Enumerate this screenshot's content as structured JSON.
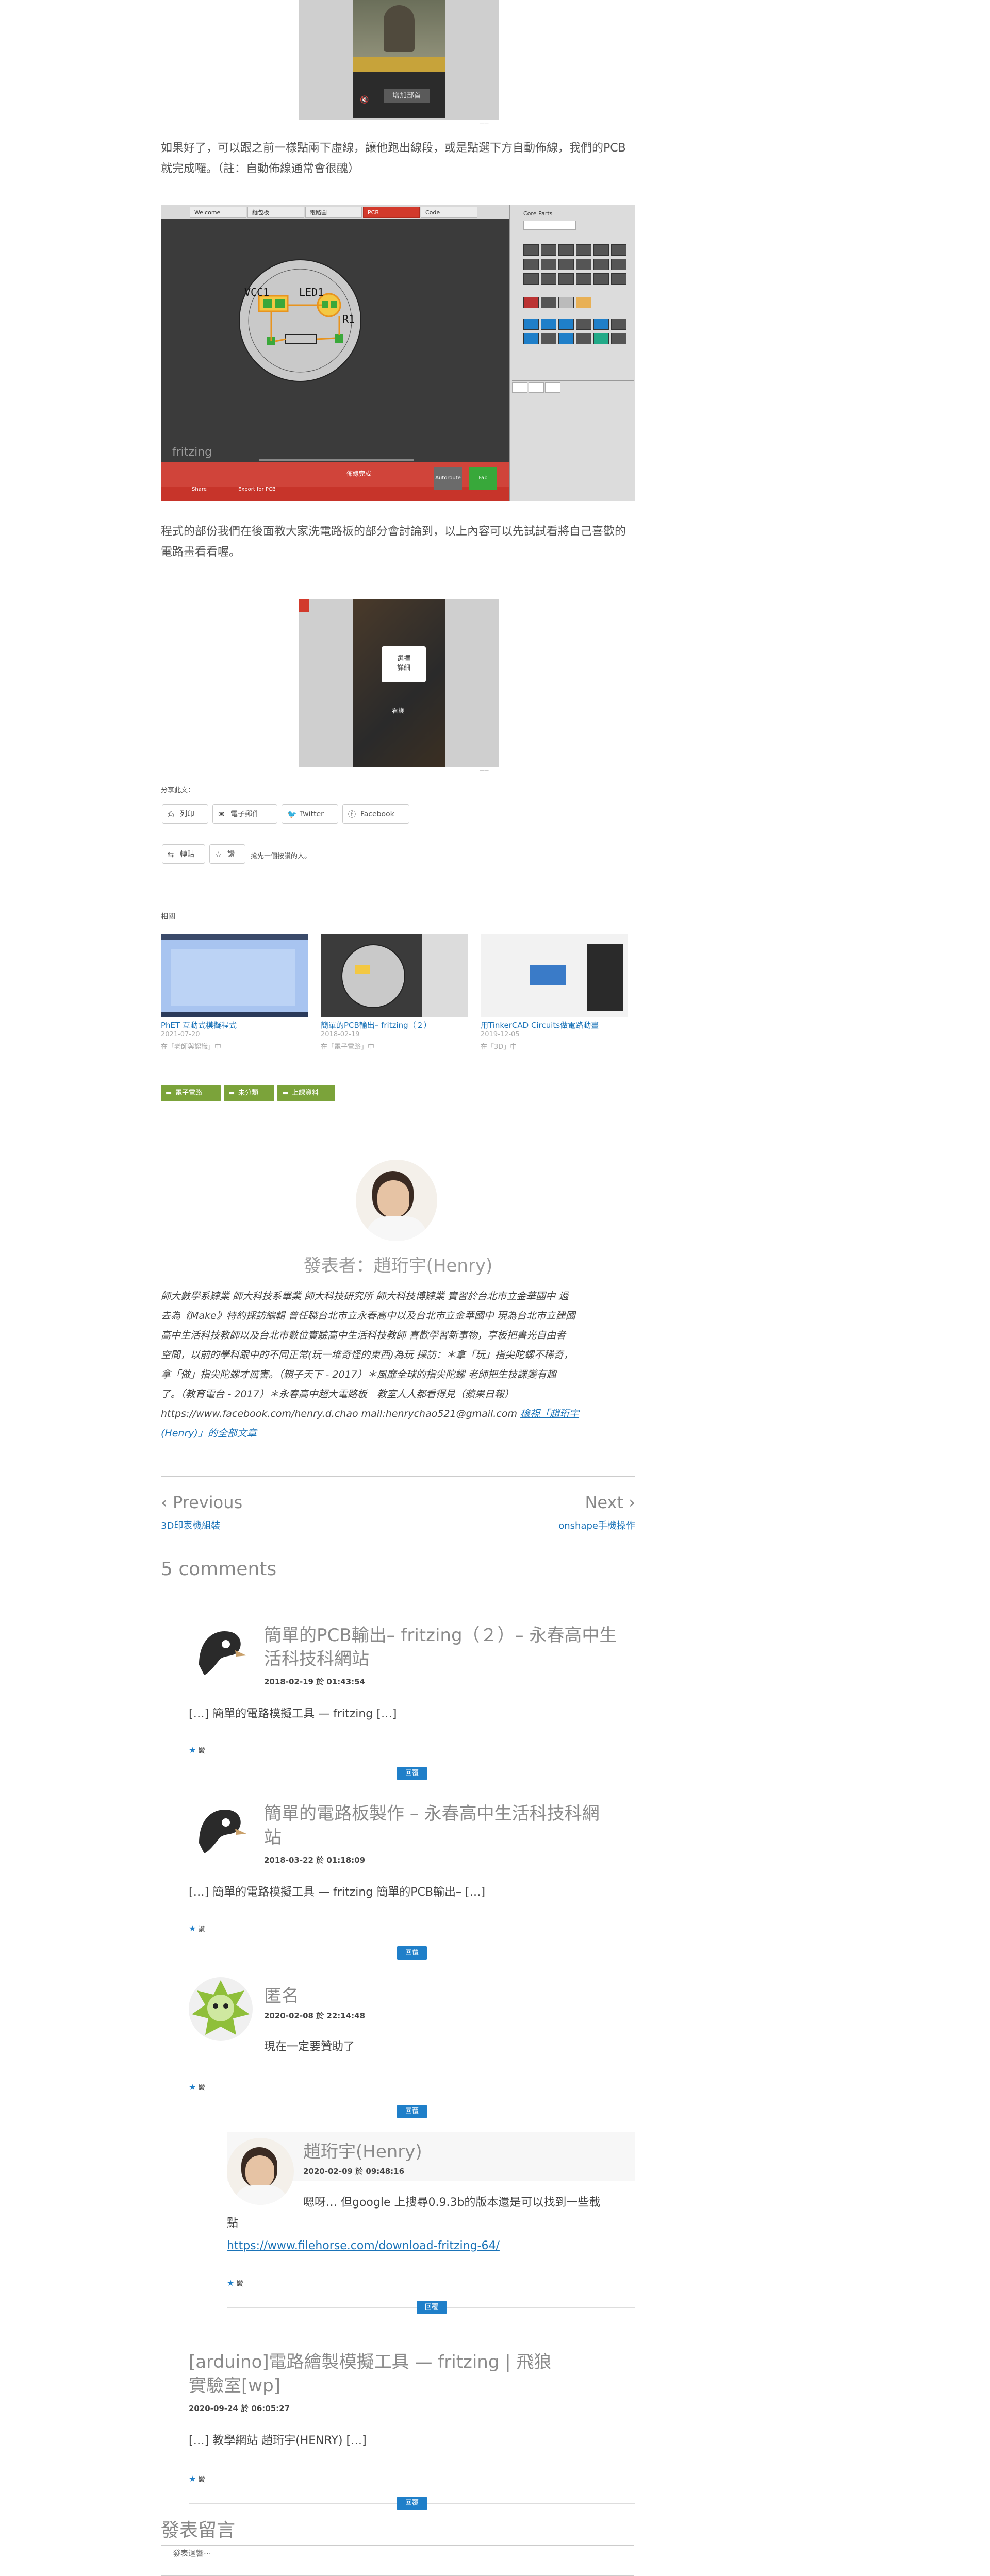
{
  "image_badge": "增加部首",
  "intro_paragraph": "如果好了，可以跟之前一樣點兩下虛線，讓他跑出線段，或是點選下方自動佈線，我們的PCB就完成囉。（註：自動佈線通常會很醜）",
  "fritzing": {
    "tabs": [
      "Welcome",
      "麵包板",
      "電路圖",
      "PCB",
      "Code"
    ],
    "board_labels": [
      "VCC1",
      "LED1",
      "R1"
    ],
    "logo": "fritzing",
    "bottom_label": "佈線完成",
    "bottom_buttons": [
      "Share",
      "Export for PCB",
      "Autoroute",
      "Fab"
    ],
    "panel_title": "Core Parts",
    "footer_buttons": [
      "Autoroute",
      "Fab"
    ]
  },
  "outro_paragraph": "程式的部份我們在後面教大家洗電路板的部分會討論到，以上內容可以先試試看將自己喜歡的電路畫看看喔。",
  "second_phone": {
    "card": "選擇\n詳細",
    "caption": "看護"
  },
  "share": {
    "label": "分享此文：",
    "buttons": [
      {
        "icon": "print-icon",
        "glyph": "⎙",
        "label": "列印"
      },
      {
        "icon": "mail-icon",
        "glyph": "✉",
        "label": "電子郵件"
      },
      {
        "icon": "twitter-icon",
        "glyph": "🐦",
        "label": "Twitter"
      },
      {
        "icon": "facebook-icon",
        "glyph": "ⓕ",
        "label": "Facebook"
      }
    ],
    "reblog": "轉貼",
    "like": "讚",
    "like_text": "搶先一個按讚的人。"
  },
  "related": {
    "label": "相關",
    "items": [
      {
        "title": "PhET 互動式模擬程式",
        "date": "2021-07-20",
        "context": "在「老師與認識」中"
      },
      {
        "title": "簡單的PCB輸出– fritzing（２）",
        "date": "2018-02-19",
        "context": "在「電子電路」中"
      },
      {
        "title": "用TinkerCAD Circuits做電路動畫",
        "date": "2019-12-05",
        "context": "在「3D」中"
      }
    ]
  },
  "tags": [
    "電子電路",
    "未分類",
    "上課資料"
  ],
  "author": {
    "title": "發表者：趙珩宇(Henry)",
    "bio_lines": [
      "師大數學系肄業 師大科技系畢業 師大科技研究所 師大科技博肄業 實習於台北市立金華國中 過",
      "去為《Make》特約採訪編輯 曾任職台北市立永春高中以及台北市立金華國中 現為台北市立建國",
      "高中生活科技教師以及台北市數位實驗高中生活科技教師 喜歡學習新事物，享板把書光自由者",
      "空間，以前的學科跟中的不同正常(玩一堆奇怪的東西)為玩 採訪：＊拿「玩」指尖陀螺不稀奇，",
      "拿「做」指尖陀螺才厲害。（親子天下 - 2017）＊風靡全球的指尖陀螺 老師把生技課變有趣",
      "了。（教育電台 - 2017）＊永春高中超大電路板　教室人人都看得見（蘋果日報）",
      "https://www.facebook.com/henry.d.chao mail:henrychao521@gmail.com"
    ],
    "link_text": "檢視「趙珩宇(Henry)」的全部文章",
    "link_part1": "檢視「趙珩宇",
    "link_part2": "(Henry)」的全部文章"
  },
  "post_nav": {
    "prev_label": "Previous",
    "prev_title": "3D印表機組裝",
    "next_label": "Next",
    "next_title": "onshape手機操作"
  },
  "comments_title": "5 comments",
  "comments": [
    {
      "name_line1": "簡單的PCB輸出– fritzing（２）– 永春高中生",
      "name_line2": "活科技科網站",
      "date": "2018-02-19 於 01:43:54",
      "text": "[…] 簡單的電路模擬工具 — fritzing […]",
      "like": "讚",
      "reply": "回覆"
    },
    {
      "name_line1": "簡單的電路板製作 – 永春高中生活科技科網",
      "name_line2": "站",
      "date": "2018-03-22 於 01:18:09",
      "text": "[…] 簡單的電路模擬工具 — fritzing 簡單的PCB輸出– […]",
      "like": "讚",
      "reply": "回覆"
    },
    {
      "name_line1": "匿名",
      "date": "2020-02-08 於 22:14:48",
      "text": "現在一定要贊助了",
      "like": "讚",
      "reply": "回覆"
    },
    {
      "name_line1": "趙珩宇(Henry)",
      "date": "2020-02-09 於 09:48:16",
      "text_line1": "嗯呀… 但google 上搜尋0.9.3b的版本還是可以找到一些載",
      "text_line2": "點",
      "link": "https://www.filehorse.com/download-fritzing-64/",
      "like": "讚",
      "reply": "回覆"
    },
    {
      "name_line1": "[arduino]電路繪製模擬工具 — fritzing | 飛狼",
      "name_line2": "實驗室[wp]",
      "date": "2020-09-24 於 06:05:27",
      "text": "[…] 教學網站 趙珩宇(HENRY) […]",
      "like": "讚",
      "reply": "回覆"
    }
  ],
  "leave_reply": {
    "title": "發表留言",
    "placeholder": "發表迴響⋯"
  }
}
